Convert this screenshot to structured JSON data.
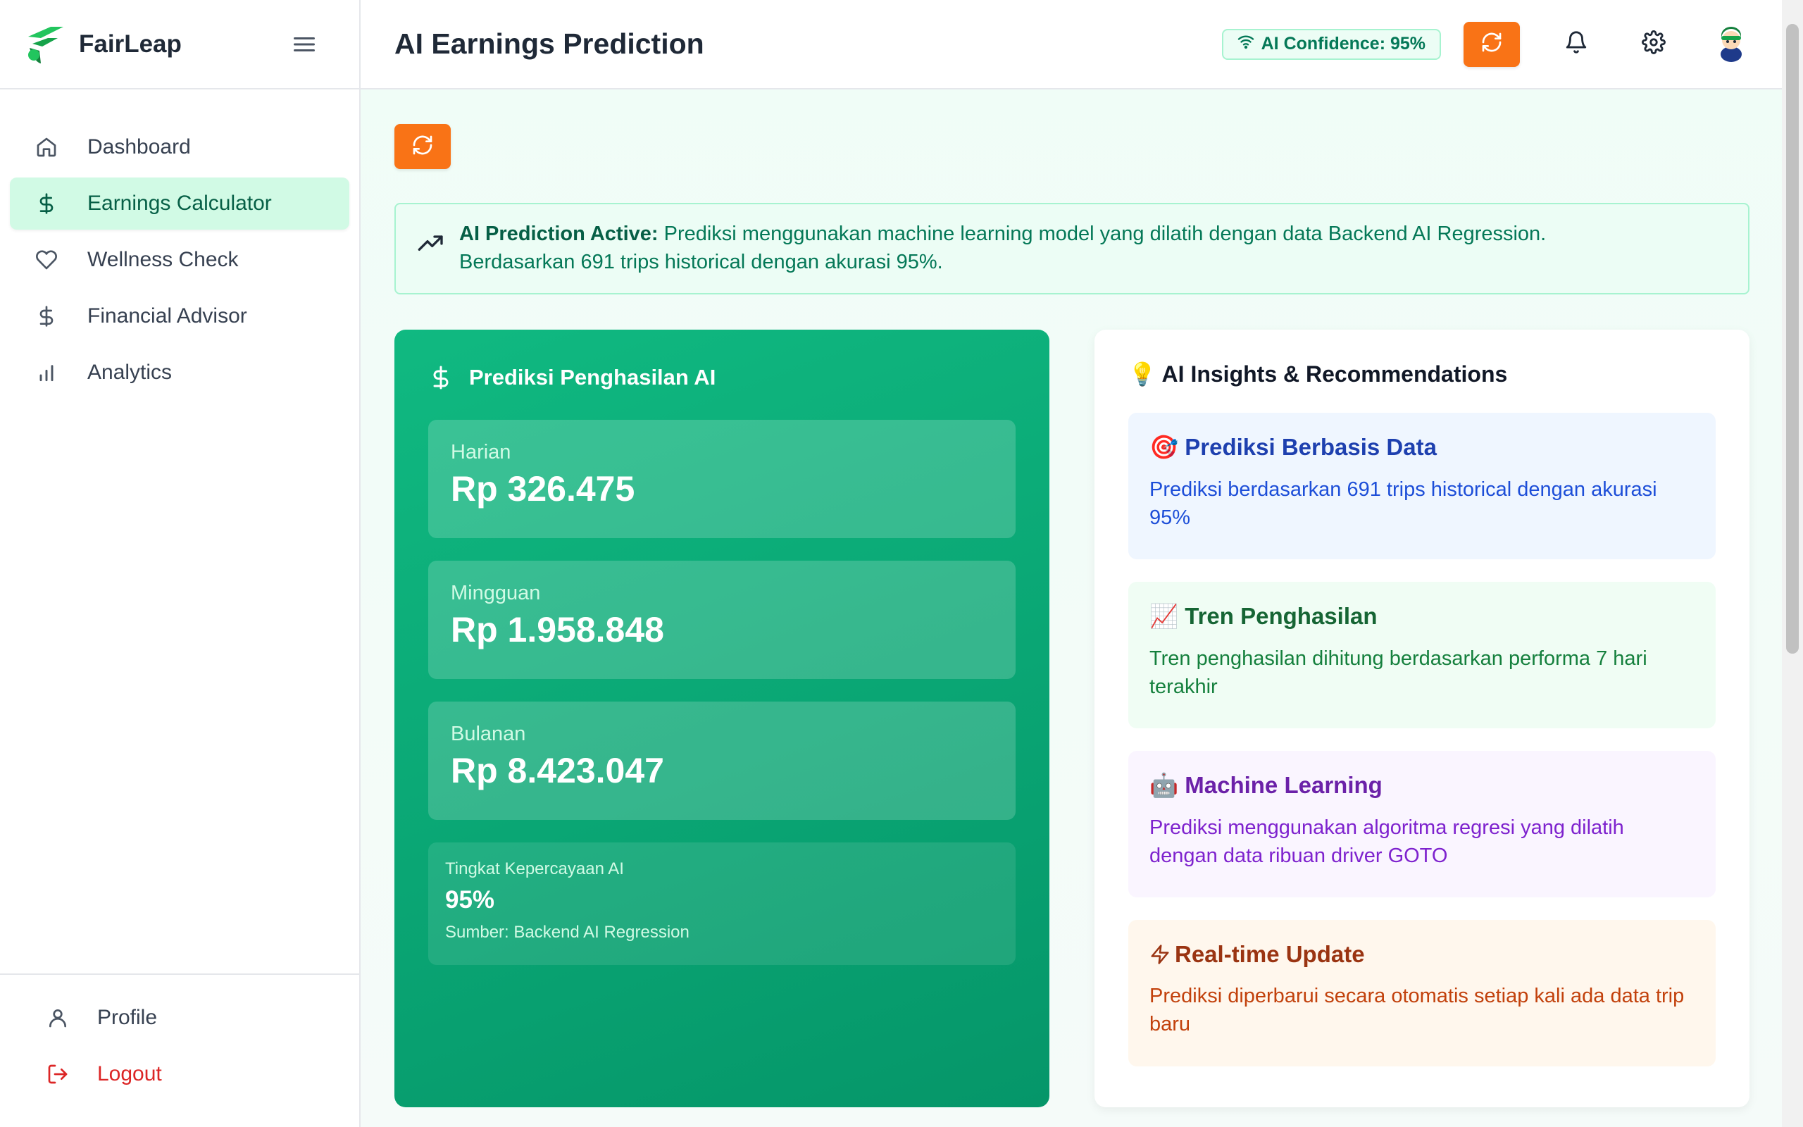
{
  "brand": {
    "name": "FairLeap",
    "accent": "#10b981"
  },
  "sidebar": {
    "items": [
      {
        "label": "Dashboard",
        "icon": "home-icon"
      },
      {
        "label": "Earnings Calculator",
        "icon": "dollar-icon",
        "active": true
      },
      {
        "label": "Wellness Check",
        "icon": "heart-icon"
      },
      {
        "label": "Financial Advisor",
        "icon": "dollar-icon"
      },
      {
        "label": "Analytics",
        "icon": "bar-chart-icon"
      }
    ],
    "bottom": [
      {
        "label": "Profile",
        "icon": "user-icon"
      },
      {
        "label": "Logout",
        "icon": "logout-icon"
      }
    ]
  },
  "header": {
    "title": "AI Earnings Prediction",
    "confidence_badge": "AI Confidence: 95%"
  },
  "banner": {
    "strong": "AI Prediction Active:",
    "text": " Prediksi menggunakan machine learning model yang dilatih dengan data Backend AI Regression.  Berdasarkan 691 trips historical dengan akurasi 95%."
  },
  "prediction": {
    "title": "Prediksi Penghasilan AI",
    "daily": {
      "label": "Harian",
      "value": "Rp 326.475"
    },
    "weekly": {
      "label": "Mingguan",
      "value": "Rp 1.958.848"
    },
    "monthly": {
      "label": "Bulanan",
      "value": "Rp 8.423.047"
    },
    "confidence": {
      "label": "Tingkat Kepercayaan AI",
      "value": "95%",
      "source": "Sumber: Backend AI Regression"
    }
  },
  "insights": {
    "title": "💡 AI Insights & Recommendations",
    "items": [
      {
        "title": "🎯 Prediksi Berbasis Data",
        "text": "Prediksi berdasarkan 691 trips historical dengan akurasi 95%"
      },
      {
        "title": "📈 Tren Penghasilan",
        "text": "Tren penghasilan dihitung berdasarkan performa 7 hari terakhir"
      },
      {
        "title": "🤖 Machine Learning",
        "text": "Prediksi menggunakan algoritma regresi yang dilatih dengan data ribuan driver GOTO"
      },
      {
        "title": "Real-time Update",
        "text": "Prediksi diperbarui secara otomatis setiap kali ada data trip baru"
      }
    ]
  }
}
